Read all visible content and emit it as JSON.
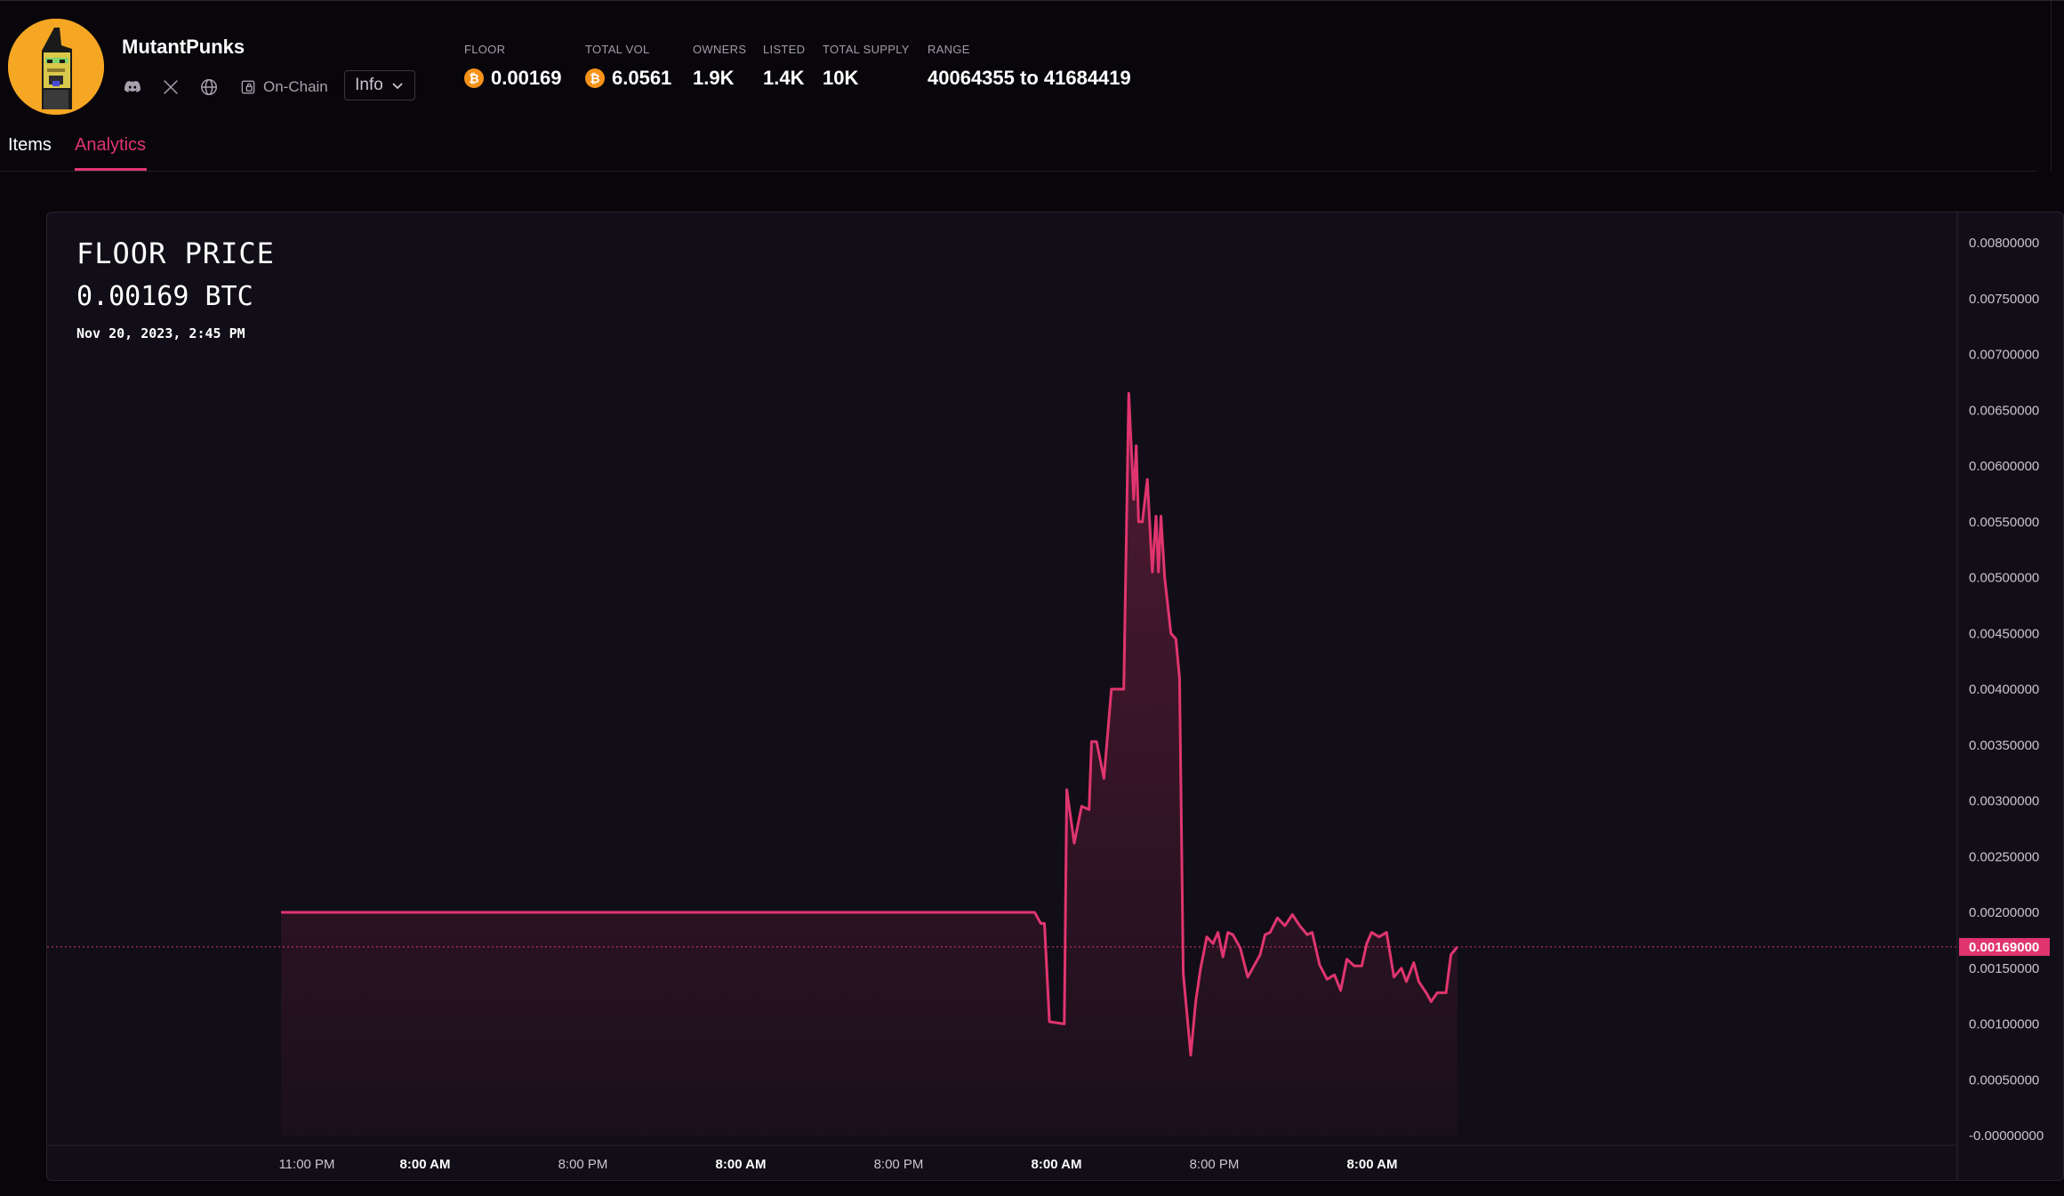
{
  "collection": {
    "name": "MutantPunks",
    "onchain_label": "On-Chain",
    "info_label": "Info"
  },
  "stats": {
    "floor": {
      "label": "FLOOR",
      "value": "0.00169"
    },
    "total_vol": {
      "label": "TOTAL VOL",
      "value": "6.0561"
    },
    "owners": {
      "label": "OWNERS",
      "value": "1.9K"
    },
    "listed": {
      "label": "LISTED",
      "value": "1.4K"
    },
    "total_supply": {
      "label": "TOTAL SUPPLY",
      "value": "10K"
    },
    "range": {
      "label": "RANGE",
      "value": "40064355 to 41684419"
    }
  },
  "tabs": {
    "items": "Items",
    "analytics": "Analytics",
    "active": "analytics"
  },
  "colors": {
    "accent": "#e0356f",
    "bitcoin": "#f7931a",
    "avatar_bg": "#f5a623"
  },
  "icons": [
    "discord-icon",
    "x-icon",
    "globe-icon",
    "on-chain-icon",
    "chevron-down-icon",
    "bitcoin-icon"
  ],
  "chart_data": {
    "type": "area",
    "title": "FLOOR PRICE",
    "current_value_text": "0.00169 BTC",
    "current_date_text": "Nov 20, 2023, 2:45 PM",
    "current_price_tag": "0.00169000",
    "current_price": 0.00169,
    "ylim": [
      0,
      0.008
    ],
    "y_ticks": [
      "0.00800000",
      "0.00750000",
      "0.00700000",
      "0.00650000",
      "0.00600000",
      "0.00550000",
      "0.00500000",
      "0.00450000",
      "0.00400000",
      "0.00350000",
      "0.00300000",
      "0.00250000",
      "0.00200000",
      "0.00150000",
      "0.00100000",
      "0.00050000",
      "-0.00000000"
    ],
    "x_ticks": [
      {
        "label": "11:00 PM",
        "bold": false
      },
      {
        "label": "8:00 AM",
        "bold": true
      },
      {
        "label": "8:00 PM",
        "bold": false
      },
      {
        "label": "8:00 AM",
        "bold": true
      },
      {
        "label": "8:00 PM",
        "bold": false
      },
      {
        "label": "8:00 AM",
        "bold": true
      },
      {
        "label": "8:00 PM",
        "bold": false
      },
      {
        "label": "8:00 AM",
        "bold": true
      }
    ],
    "x_unit": "hours since 11:00 PM",
    "x_range": [
      0,
      94
    ],
    "grid": false,
    "series": [
      {
        "points": [
          [
            -1,
            0.002
          ],
          [
            10,
            0.002
          ],
          [
            20,
            0.002
          ],
          [
            30,
            0.002
          ],
          [
            40,
            0.002
          ],
          [
            50,
            0.002
          ],
          [
            59.8,
            0.002
          ],
          [
            60.3,
            0.0019
          ],
          [
            60.6,
            0.0019
          ],
          [
            61.0,
            0.00102
          ],
          [
            62.2,
            0.001
          ],
          [
            62.4,
            0.0031
          ],
          [
            63.0,
            0.00262
          ],
          [
            63.6,
            0.00295
          ],
          [
            64.2,
            0.00292
          ],
          [
            64.4,
            0.00353
          ],
          [
            64.8,
            0.00353
          ],
          [
            65.4,
            0.0032
          ],
          [
            66.0,
            0.004
          ],
          [
            67.0,
            0.004
          ],
          [
            67.4,
            0.00665
          ],
          [
            67.8,
            0.0057
          ],
          [
            68.0,
            0.00618
          ],
          [
            68.2,
            0.0055
          ],
          [
            68.5,
            0.0055
          ],
          [
            68.9,
            0.00588
          ],
          [
            69.3,
            0.00505
          ],
          [
            69.6,
            0.00555
          ],
          [
            69.8,
            0.00505
          ],
          [
            70.0,
            0.00555
          ],
          [
            70.3,
            0.005
          ],
          [
            70.8,
            0.0045
          ],
          [
            71.2,
            0.00445
          ],
          [
            71.5,
            0.0041
          ],
          [
            71.8,
            0.00145
          ],
          [
            72.4,
            0.00072
          ],
          [
            72.8,
            0.0012
          ],
          [
            73.2,
            0.0015
          ],
          [
            73.7,
            0.00178
          ],
          [
            74.2,
            0.00172
          ],
          [
            74.6,
            0.00182
          ],
          [
            75.0,
            0.0016
          ],
          [
            75.4,
            0.00182
          ],
          [
            75.8,
            0.0018
          ],
          [
            76.4,
            0.00168
          ],
          [
            77.0,
            0.00142
          ],
          [
            77.4,
            0.0015
          ],
          [
            78.0,
            0.00162
          ],
          [
            78.4,
            0.0018
          ],
          [
            78.8,
            0.00182
          ],
          [
            79.4,
            0.00195
          ],
          [
            80.0,
            0.00188
          ],
          [
            80.6,
            0.00198
          ],
          [
            81.2,
            0.00188
          ],
          [
            81.8,
            0.0018
          ],
          [
            82.2,
            0.00182
          ],
          [
            82.8,
            0.00153
          ],
          [
            83.4,
            0.0014
          ],
          [
            84.0,
            0.00144
          ],
          [
            84.5,
            0.0013
          ],
          [
            85.0,
            0.00158
          ],
          [
            85.6,
            0.00152
          ],
          [
            86.2,
            0.00152
          ],
          [
            86.6,
            0.00172
          ],
          [
            87.0,
            0.00182
          ],
          [
            87.6,
            0.00178
          ],
          [
            88.2,
            0.00182
          ],
          [
            88.8,
            0.00142
          ],
          [
            89.4,
            0.0015
          ],
          [
            89.8,
            0.00138
          ],
          [
            90.4,
            0.00155
          ],
          [
            90.8,
            0.00138
          ],
          [
            91.4,
            0.00128
          ],
          [
            91.8,
            0.0012
          ],
          [
            92.3,
            0.00128
          ],
          [
            93.0,
            0.00128
          ],
          [
            93.4,
            0.00162
          ],
          [
            93.9,
            0.00169
          ]
        ]
      }
    ]
  }
}
